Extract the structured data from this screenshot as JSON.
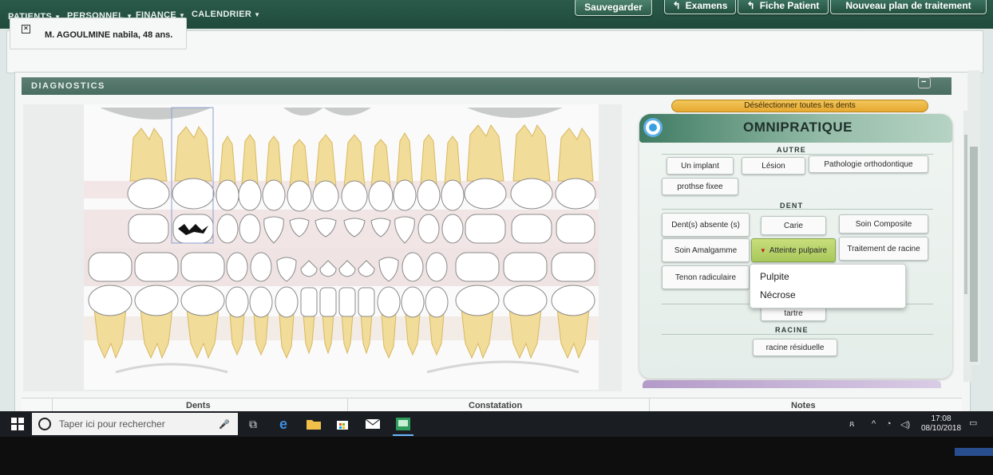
{
  "nav": {
    "items": [
      "PATIENTS",
      "PERSONNEL",
      "FINANCE",
      "CALENDRIER"
    ],
    "save_label": "Sauvegarder",
    "buttons": [
      "Examens",
      "Fiche Patient",
      "Nouveau plan de traitement"
    ]
  },
  "patient": {
    "name": "M. AGOULMINE nabila, 48 ans."
  },
  "diagnostics": {
    "title": "DIAGNOSTICS"
  },
  "omni": {
    "deselect_label": "Désélectionner toutes les dents",
    "title": "OMNIPRATIQUE",
    "sections": {
      "autre": "AUTRE",
      "dent": "DENT",
      "racine": "RACINE"
    },
    "autre_buttons": [
      "Un implant",
      "Lésion",
      "Pathologie orthodontique",
      "prothse fixee"
    ],
    "dent_buttons": [
      "Dent(s) absente (s)",
      "Carie",
      "Soin Composite",
      "Soin Amalgamme",
      "Atteinte pulpaire",
      "Traitement de racine",
      "Tenon radiculaire",
      "tartre"
    ],
    "racine_buttons": [
      "racine résiduelle"
    ],
    "dropdown_items": [
      "Pulpite",
      "Nécrose"
    ]
  },
  "table": {
    "headers": [
      "Dents",
      "Constatation",
      "Notes"
    ]
  },
  "taskbar": {
    "search_placeholder": "Taper ici pour rechercher",
    "time": "17:08",
    "date": "08/10/2018"
  },
  "colors": {
    "nav_bg": "#2a5a4a",
    "accent": "#3f7b63",
    "active_button": "#b8d26a",
    "deselect": "#efb942"
  }
}
